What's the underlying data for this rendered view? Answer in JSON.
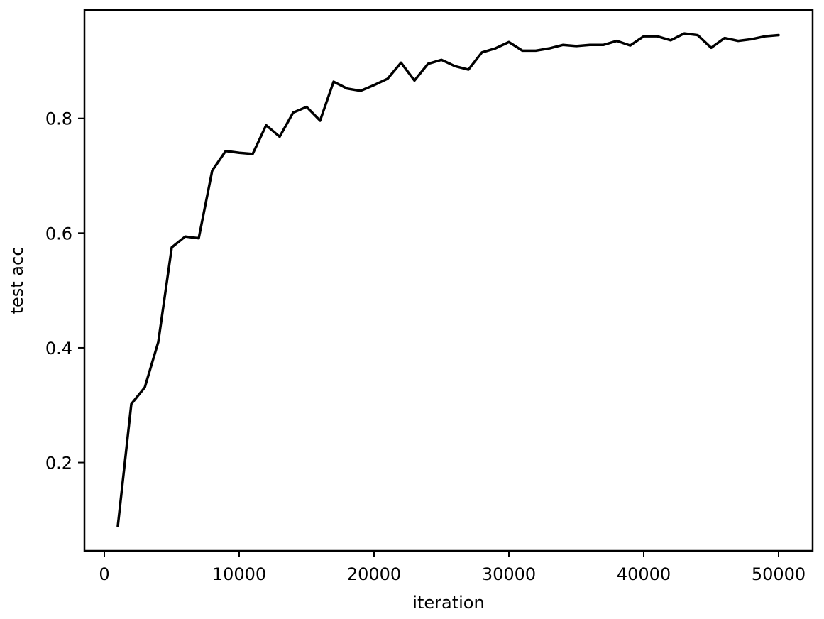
{
  "chart_data": {
    "type": "line",
    "title": "",
    "xlabel": "iteration",
    "ylabel": "test acc",
    "xlim": [
      -1474,
      52526
    ],
    "ylim": [
      0.046,
      0.989
    ],
    "xticks": [
      0,
      10000,
      20000,
      30000,
      40000,
      50000
    ],
    "xtick_labels": [
      "0",
      "10000",
      "20000",
      "30000",
      "40000",
      "50000"
    ],
    "yticks": [
      0.2,
      0.4,
      0.6,
      0.8
    ],
    "ytick_labels": [
      "0.2",
      "0.4",
      "0.6",
      "0.8"
    ],
    "grid": false,
    "legend": null,
    "series": [
      {
        "name": "test acc",
        "color": "#000000",
        "x": [
          1000,
          2000,
          3000,
          4000,
          5000,
          6000,
          7000,
          8000,
          9000,
          10000,
          11000,
          12000,
          13000,
          14000,
          15000,
          16000,
          17000,
          18000,
          19000,
          20000,
          21000,
          22000,
          23000,
          24000,
          25000,
          26000,
          27000,
          28000,
          29000,
          30000,
          31000,
          32000,
          33000,
          34000,
          35000,
          36000,
          37000,
          38000,
          39000,
          40000,
          41000,
          42000,
          43000,
          44000,
          45000,
          46000,
          47000,
          48000,
          49000,
          50000
        ],
        "y": [
          0.089,
          0.302,
          0.331,
          0.41,
          0.575,
          0.594,
          0.591,
          0.709,
          0.743,
          0.74,
          0.738,
          0.788,
          0.768,
          0.81,
          0.82,
          0.796,
          0.864,
          0.852,
          0.848,
          0.858,
          0.869,
          0.897,
          0.866,
          0.895,
          0.902,
          0.891,
          0.885,
          0.915,
          0.922,
          0.933,
          0.918,
          0.918,
          0.922,
          0.928,
          0.926,
          0.928,
          0.928,
          0.935,
          0.927,
          0.943,
          0.943,
          0.936,
          0.948,
          0.945,
          0.923,
          0.94,
          0.935,
          0.938,
          0.943,
          0.945
        ]
      }
    ]
  }
}
